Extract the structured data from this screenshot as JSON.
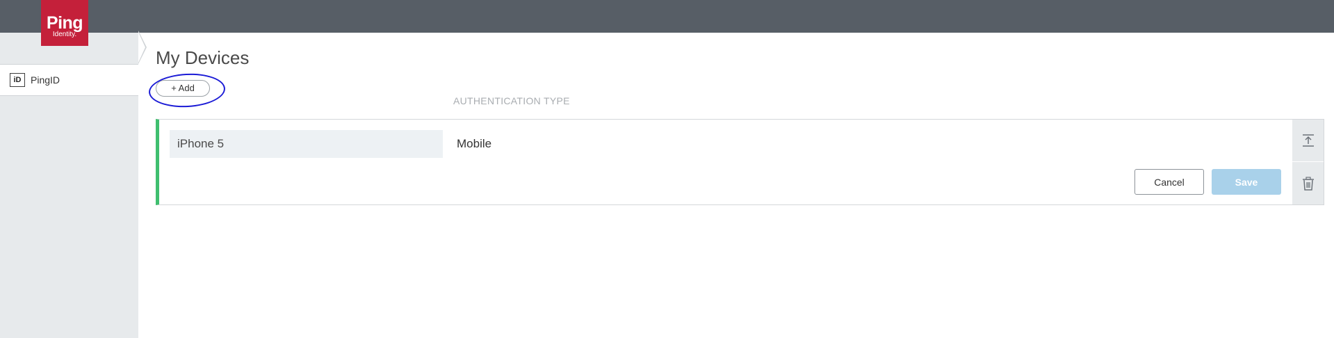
{
  "brand": {
    "name": "Ping",
    "sub": "Identity."
  },
  "sidebar": {
    "items": [
      {
        "icon": "pingid-icon",
        "icon_text": "iD",
        "label": "PingID"
      }
    ]
  },
  "main": {
    "title": "My Devices",
    "add_label": "+ Add",
    "column_header": "AUTHENTICATION TYPE",
    "device": {
      "name_value": "iPhone 5",
      "auth_type": "Mobile",
      "cancel_label": "Cancel",
      "save_label": "Save",
      "status_color": "#3fbf6f"
    }
  },
  "colors": {
    "topbar": "#575e66",
    "brand": "#c4203a",
    "sidebar": "#e7eaec",
    "save_disabled": "#a9d1ea",
    "annotation": "#1b1bd6"
  }
}
